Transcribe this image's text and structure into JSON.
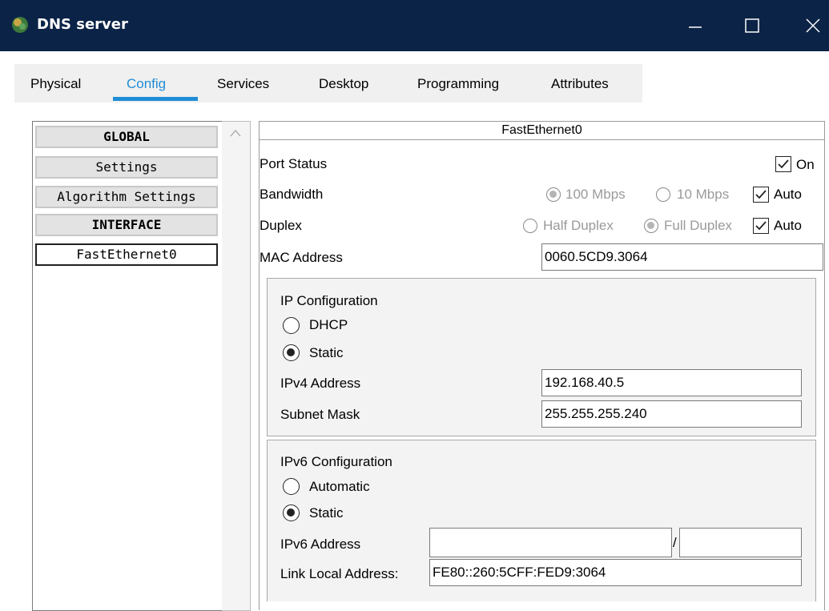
{
  "window": {
    "title": "DNS server"
  },
  "tabs": [
    "Physical",
    "Config",
    "Services",
    "Desktop",
    "Programming",
    "Attributes"
  ],
  "nav": {
    "global": "GLOBAL",
    "settings": "Settings",
    "algorithm_settings": "Algorithm Settings",
    "interface": "INTERFACE",
    "fastethernet": "FastEthernet0"
  },
  "panel": {
    "title": "FastEthernet0",
    "port_status": {
      "label": "Port Status",
      "on_label": "On",
      "checked": true
    },
    "bandwidth": {
      "label": "Bandwidth",
      "opt1": "100 Mbps",
      "opt2": "10 Mbps",
      "auto_label": "Auto"
    },
    "duplex": {
      "label": "Duplex",
      "opt1": "Half Duplex",
      "opt2": "Full Duplex",
      "auto_label": "Auto"
    },
    "mac": {
      "label": "MAC Address",
      "value": "0060.5CD9.3064"
    }
  },
  "ip_config": {
    "heading": "IP Configuration",
    "dhcp": "DHCP",
    "static": "Static",
    "ipv4_label": "IPv4 Address",
    "ipv4_value": "192.168.40.5",
    "mask_label": "Subnet Mask",
    "mask_value": "255.255.255.240"
  },
  "ipv6_config": {
    "heading": "IPv6 Configuration",
    "automatic": "Automatic",
    "static": "Static",
    "ipv6_label": "IPv6 Address",
    "ipv6_value": "",
    "prefix_sep": "/",
    "prefix_value": "",
    "link_local_label": "Link Local Address:",
    "link_local_value": "FE80::260:5CFF:FED9:3064"
  },
  "colors": {
    "titlebar": "#0b2346",
    "accent": "#1f8dd6"
  }
}
